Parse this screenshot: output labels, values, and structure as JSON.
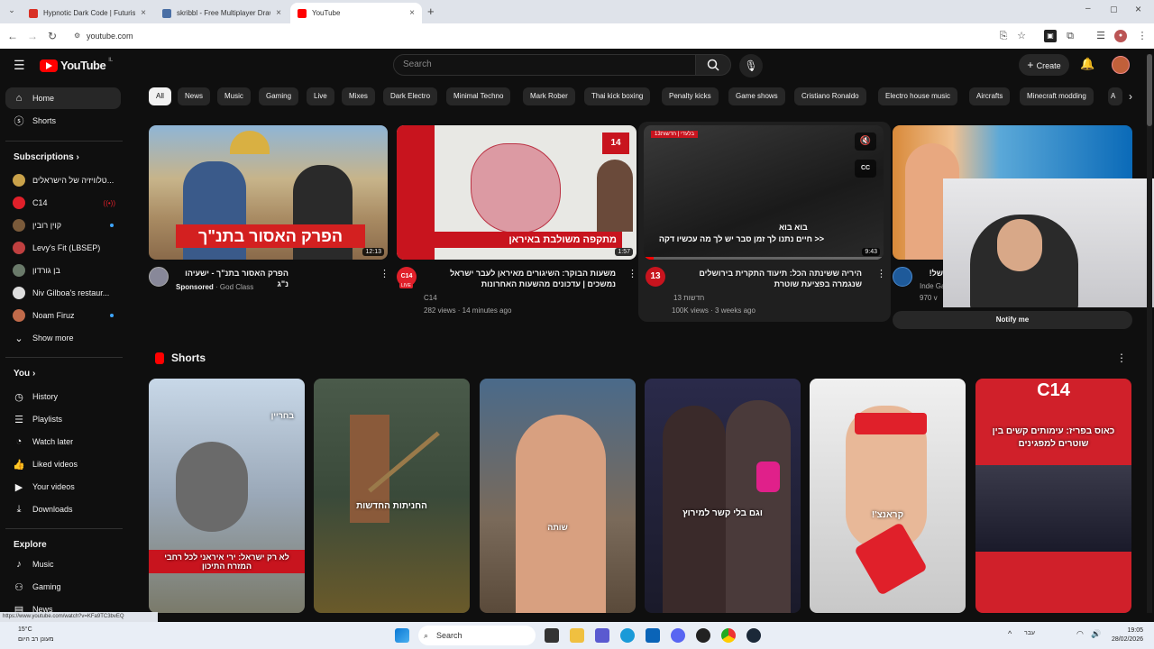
{
  "browser": {
    "tabs": [
      {
        "title": "Hypnotic Dark Code | Futuristi",
        "color": "#d93025"
      },
      {
        "title": "skribbl - Free Multiplayer Drawi",
        "color": "#4a6fa5"
      },
      {
        "title": "YouTube",
        "color": "#ff0000"
      }
    ],
    "url": "youtube.com",
    "status_url": "https://www.youtube.com/watch?v=KFa9TC3bvEQ"
  },
  "header": {
    "logo": "YouTube",
    "country": "IL",
    "search_placeholder": "Search",
    "create_label": "Create"
  },
  "sidebar": {
    "home": "Home",
    "shorts": "Shorts",
    "subscriptions_title": "Subscriptions",
    "subscriptions": [
      {
        "label": "טלוויזיה של הישראלים...",
        "color": "#c9a24a"
      },
      {
        "label": "C14",
        "color": "#e0202a"
      },
      {
        "label": "קוין רובין",
        "color": "#7a5a3a"
      },
      {
        "label": "Levy's Fit (LBSEP)",
        "color": "#c04040"
      },
      {
        "label": "בן גורדון",
        "color": "#6a7a6a"
      },
      {
        "label": "Niv Gilboa's restaur...",
        "color": "#dddddd"
      },
      {
        "label": "Noam Firuz",
        "color": "#c06a4a"
      }
    ],
    "show_more": "Show more",
    "you_title": "You",
    "you_items": [
      "History",
      "Playlists",
      "Watch later",
      "Liked videos",
      "Your videos",
      "Downloads"
    ],
    "explore_title": "Explore",
    "explore_items": [
      "Music",
      "Gaming",
      "News"
    ]
  },
  "chips": [
    "All",
    "News",
    "Music",
    "Gaming",
    "Live",
    "Mixes",
    "Dark Electro",
    "Minimal Techno",
    "Mark Rober",
    "Thai kick boxing",
    "Penalty kicks",
    "Game shows",
    "Cristiano Ronaldo",
    "Electro house music",
    "Aircrafts",
    "Minecraft modding",
    "A"
  ],
  "videos": [
    {
      "title": "הפרק האסור בתנ\"ך - ישעיהו נ\"ג",
      "channel": "God Class",
      "sponsored": "Sponsored",
      "meta": "",
      "duration": "12:13",
      "overlay": "הפרק האסור בתנ\"ך"
    },
    {
      "title": "משעות הבוקר: השיגורים מאיראן לעבר ישראל נמשכים | עדכונים מהשעות האחרונות",
      "channel": "C14",
      "meta": "282 views · 14 minutes ago",
      "duration": "1:57",
      "overlay": "מתקפה משולבת באיראן",
      "live": "LIVE"
    },
    {
      "title": "היריה ששינתה הכל: תיעוד התקרית בירושלים שנגמרה בפציעת שוטרת",
      "channel": "חדשות 13",
      "meta": "100K views · 3 weeks ago",
      "duration": "9:43",
      "overlay": "בוא בוא",
      "overlay2": "<< חיים נתנו לך זמן סבר יש לך מה עכשיו דקה"
    },
    {
      "title": "של!",
      "channel": "Inde Ga",
      "meta": "970 v",
      "notify": "Notify me"
    }
  ],
  "shorts_title": "Shorts",
  "shorts": [
    {
      "caption": "לא רק ישראל: ירי איראני לכל רחבי המזרח התיכון",
      "tag": "בחריין"
    },
    {
      "caption": "החניתות החדשות"
    },
    {
      "caption": "שותה"
    },
    {
      "caption": "וגם בלי קשר למירוץ"
    },
    {
      "caption": "קראנצ'!"
    },
    {
      "caption": "כאוס בפריז: עימותים קשים בין שוטרים למפגינים",
      "tag": "C14"
    }
  ],
  "taskbar": {
    "weather_temp": "15°C",
    "weather_desc": "מעונן רב היום",
    "search": "Search",
    "lang": "עבר",
    "time": "19:05",
    "date": "28/02/2026"
  }
}
